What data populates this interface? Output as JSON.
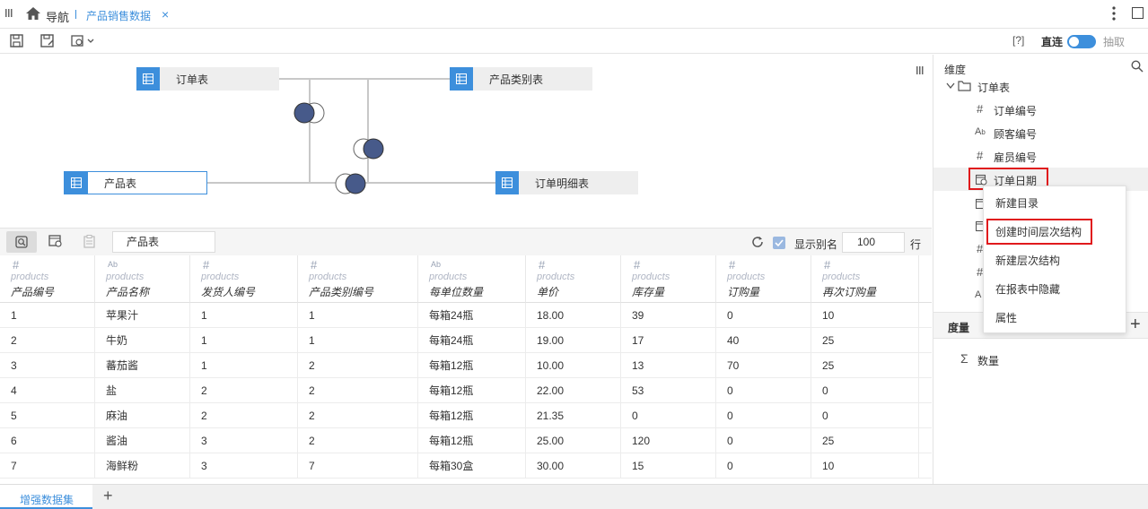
{
  "titlebar": {
    "nav_label": "导航",
    "active_tab": "产品销售数据",
    "close_glyph": "×"
  },
  "toolbar": {
    "help_label": "[?]",
    "direct_label": "直连",
    "extract_label": "抽取",
    "accent": "#3d8fdc"
  },
  "diagram": {
    "tables": [
      "订单表",
      "产品类别表",
      "产品表",
      "订单明细表"
    ]
  },
  "gridbar": {
    "table_name": "产品表",
    "show_alias_label": "显示别名",
    "rows_value": "100",
    "rows_unit": "行"
  },
  "grid": {
    "columns": [
      {
        "type": "#",
        "src": "products",
        "name": "产品编号"
      },
      {
        "type": "Ab",
        "src": "products",
        "name": "产品名称"
      },
      {
        "type": "#",
        "src": "products",
        "name": "发货人编号"
      },
      {
        "type": "#",
        "src": "products",
        "name": "产品类别编号"
      },
      {
        "type": "Ab",
        "src": "products",
        "name": "每单位数量"
      },
      {
        "type": "#",
        "src": "products",
        "name": "单价"
      },
      {
        "type": "#",
        "src": "products",
        "name": "库存量"
      },
      {
        "type": "#",
        "src": "products",
        "name": "订购量"
      },
      {
        "type": "#",
        "src": "products",
        "name": "再次订购量"
      }
    ],
    "rows": [
      [
        "1",
        "苹果汁",
        "1",
        "1",
        "每箱24瓶",
        "18.00",
        "39",
        "0",
        "10"
      ],
      [
        "2",
        "牛奶",
        "1",
        "1",
        "每箱24瓶",
        "19.00",
        "17",
        "40",
        "25"
      ],
      [
        "3",
        "蕃茄酱",
        "1",
        "2",
        "每箱12瓶",
        "10.00",
        "13",
        "70",
        "25"
      ],
      [
        "4",
        "盐",
        "2",
        "2",
        "每箱12瓶",
        "22.00",
        "53",
        "0",
        "0"
      ],
      [
        "5",
        "麻油",
        "2",
        "2",
        "每箱12瓶",
        "21.35",
        "0",
        "0",
        "0"
      ],
      [
        "6",
        "酱油",
        "3",
        "2",
        "每箱12瓶",
        "25.00",
        "120",
        "0",
        "25"
      ],
      [
        "7",
        "海鲜粉",
        "3",
        "7",
        "每箱30盒",
        "30.00",
        "15",
        "0",
        "10"
      ]
    ]
  },
  "bottom": {
    "tab_label": "增强数据集",
    "add_glyph": "+"
  },
  "rightpanel": {
    "dimension_title": "维度",
    "folder_label": "订单表",
    "fields": [
      {
        "type": "#",
        "label": "订单编号"
      },
      {
        "type": "Ab",
        "label": "顾客编号"
      },
      {
        "type": "#",
        "label": "雇员编号"
      },
      {
        "type": "date",
        "label": "订单日期"
      }
    ],
    "measure_title": "度量",
    "measure_item": "数量",
    "add_glyph": "+"
  },
  "contextmenu": {
    "items": [
      "新建目录",
      "创建时间层次结构",
      "新建层次结构",
      "在报表中隐藏",
      "属性"
    ]
  }
}
